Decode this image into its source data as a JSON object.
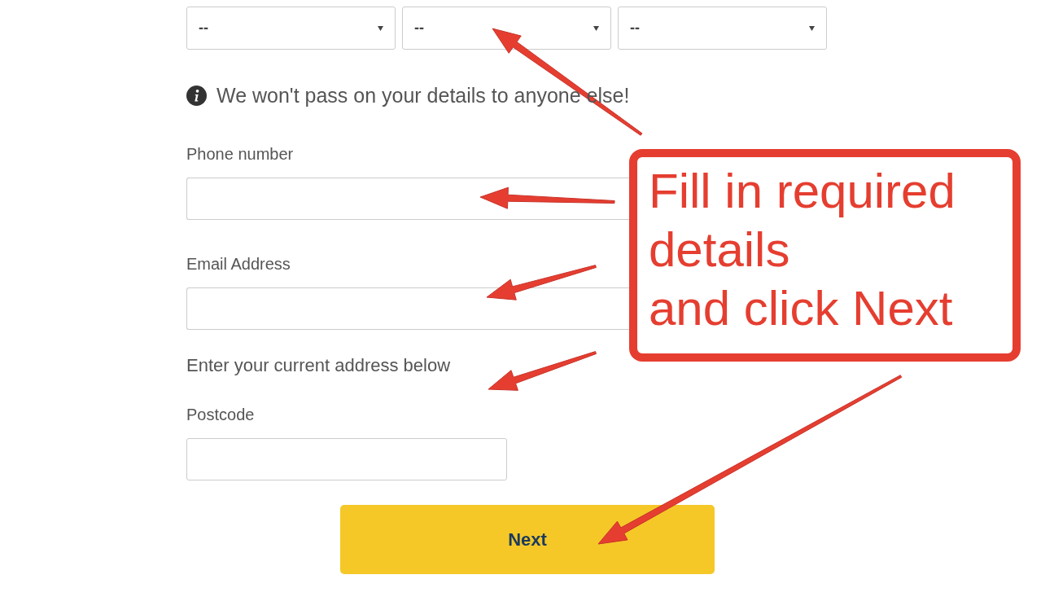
{
  "date_selects": [
    {
      "value": "--"
    },
    {
      "value": "--"
    },
    {
      "value": "--"
    }
  ],
  "privacy_note": "We won't pass on your details to anyone else!",
  "fields": [
    {
      "label": "Phone number"
    },
    {
      "label": "Email Address"
    }
  ],
  "address_prompt": "Enter your current address below",
  "postcode": {
    "label": "Postcode"
  },
  "next_button": "Next",
  "annotation": {
    "lines": [
      "Fill in required",
      "details",
      "and click Next"
    ]
  }
}
